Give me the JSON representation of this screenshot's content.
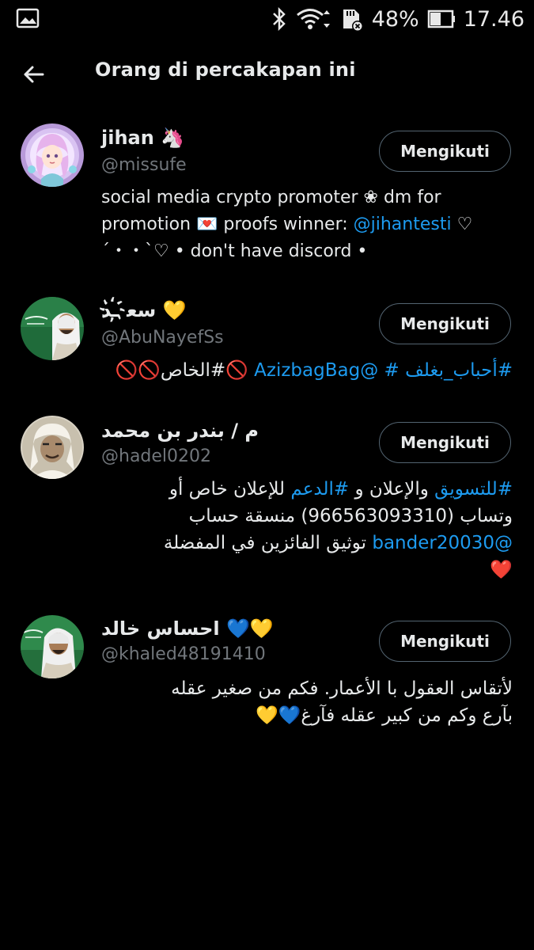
{
  "status_bar": {
    "battery": "48%",
    "time": "17.46",
    "icons": [
      "gallery-icon",
      "bluetooth-icon",
      "wifi-icon",
      "sd-card-icon",
      "battery-icon"
    ]
  },
  "header": {
    "title": "Orang di percakapan ini"
  },
  "colors": {
    "background": "#000000",
    "text": "#e7e9ea",
    "secondary": "#71767b",
    "link": "#1d9bf0",
    "button_border": "#536471"
  },
  "users": [
    {
      "name": "jihan 🦄",
      "handle": "@missufe",
      "button": "Mengikuti",
      "bio": {
        "line1": "social media crypto promoter ❀ dm for",
        "line2_a": "promotion 💌 proofs winner: ",
        "line2_link": "@jihantesti",
        "line2_b": " ♡",
        "line3": "´・・`♡ • don't have discord •"
      }
    },
    {
      "name": "سع҉ـد 💛",
      "handle": "@AbuNayefSs",
      "button": "Mengikuti",
      "bio": {
        "tag1": "#أحباب_بغلف",
        "tag2": "#",
        "mention": "@AzizbagBag",
        "tag3": "🚫#الخاص🚫🚫"
      }
    },
    {
      "name": "م / بندر بن محمد",
      "handle": "@hadel0202",
      "button": "Mengikuti",
      "bio": {
        "line1_link1": "#للتسويق",
        "line1_a": " والإعلان و ",
        "line1_link2": "#الدعم",
        "line1_b": " للإعلان خاص أو",
        "line2": "وتساب (966563093310) منسقة حساب",
        "line3_link": "@bander20030",
        "line3_b": " توثيق الفائزين في المفضلة",
        "line4": "❤️"
      }
    },
    {
      "name": "احساس خالد 💙💛",
      "handle": "@khaled48191410",
      "button": "Mengikuti",
      "bio": {
        "line1": "لأتقاس العقول با الأعمار. فكم من صغير عقله",
        "line2": "بآرع وكم من كبير عقله فآرغ💙💛"
      }
    }
  ]
}
